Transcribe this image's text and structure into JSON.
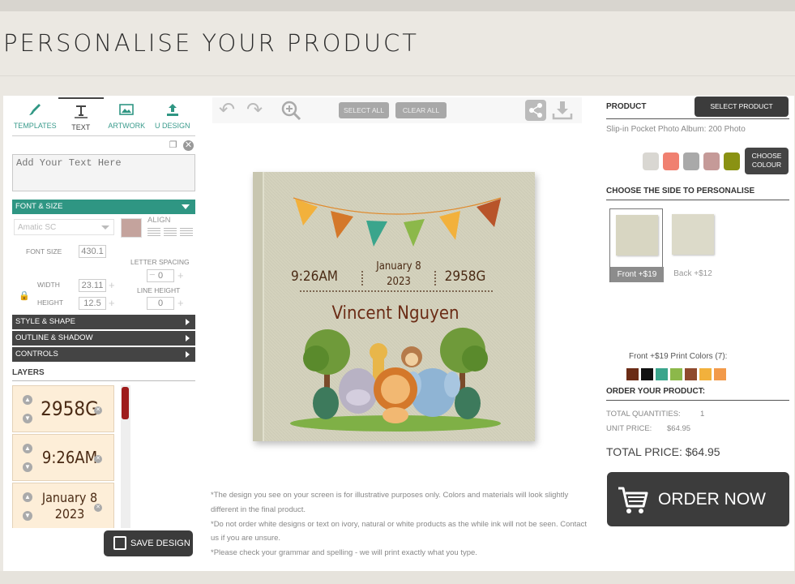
{
  "page_title": "PERSONALISE YOUR PRODUCT",
  "tabs": [
    {
      "label": "TEMPLATES",
      "icon": "brush-icon"
    },
    {
      "label": "TEXT",
      "icon": "text-tool-icon"
    },
    {
      "label": "ARTWORK",
      "icon": "image-icon"
    },
    {
      "label": "U DESIGN",
      "icon": "upload-icon"
    }
  ],
  "text_input": {
    "placeholder": "Add Your Text Here"
  },
  "font_size_section": "FONT & SIZE",
  "font_select": "Amatic SC",
  "align_label": "ALIGN",
  "font_size": {
    "label": "FONT SIZE",
    "value": "430.1"
  },
  "letter_spacing": {
    "label": "LETTER SPACING",
    "value": "0"
  },
  "width": {
    "label": "WIDTH",
    "value": "23.11"
  },
  "height": {
    "label": "HEIGHT",
    "value": "12.5"
  },
  "line_height": {
    "label": "LINE HEIGHT",
    "value": "0"
  },
  "sections": [
    "STYLE & SHAPE",
    "OUTLINE & SHADOW",
    "CONTROLS"
  ],
  "layers_label": "LAYERS",
  "layers": [
    {
      "line1": "2958G",
      "line2": ""
    },
    {
      "line1": "9:26AM",
      "line2": ""
    },
    {
      "line1": "January 8",
      "line2": "2023"
    }
  ],
  "save_design": "SAVE DESIGN",
  "toolbar": {
    "select_all": "SELECT ALL",
    "clear_all": "CLEAR ALL"
  },
  "album": {
    "time": "9:26AM",
    "date_line1": "January 8",
    "date_line2": "2023",
    "weight": "2958G",
    "name": "Vincent Nguyen"
  },
  "disclaimer": [
    "*The design you see on your screen is for illustrative purposes only. Colors and materials will look slightly different in the final product.",
    "*Do not order white designs or text on ivory, natural or white products as the while ink will not be seen. Contact us if you are unsure.",
    "*Please check your grammar and spelling - we will print exactly what you type."
  ],
  "product": {
    "heading": "PRODUCT",
    "select_button": "SELECT PRODUCT",
    "name": "Slip-in Pocket Photo Album: 200 Photo",
    "colours": [
      "#d9d7d2",
      "#f08070",
      "#a9a9a9",
      "#c59a98",
      "#8a9213"
    ],
    "choose_colour_line1": "CHOOSE",
    "choose_colour_line2": "COLOUR"
  },
  "sides": {
    "heading": "CHOOSE THE SIDE TO PERSONALISE",
    "front": "Front +$19",
    "back": "Back +$12"
  },
  "print_colors": {
    "label": "Front +$19 Print Colors  (7):",
    "colors": [
      "#6b2c16",
      "#111111",
      "#3aa58c",
      "#8cb84a",
      "#8f4a2d",
      "#f2b13c",
      "#f29a4a"
    ]
  },
  "order": {
    "heading": "ORDER YOUR PRODUCT:",
    "total_quantities_label": "TOTAL QUANTITIES:",
    "total_quantities": "1",
    "unit_price_label": "UNIT PRICE:",
    "unit_price": "$64.95",
    "total_price": "TOTAL PRICE: $64.95",
    "order_now": "ORDER NOW"
  }
}
